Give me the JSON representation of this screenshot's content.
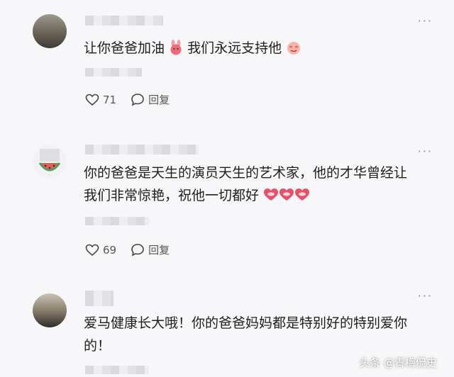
{
  "comments": [
    {
      "text_a": "让你爸爸加油",
      "text_b": "我们永远支持他",
      "likes": "71",
      "reply_label": "回复",
      "more": "···"
    },
    {
      "text_line1": "你的爸爸是天生的演员天生的艺术家，他的才华曾经让",
      "text_line2": "我们非常惊艳，祝他一切都好",
      "likes": "69",
      "reply_label": "回复",
      "more": "···"
    },
    {
      "text_line1": "爱马健康长大哦！你的爸爸妈妈都是特别好的特别爱你",
      "text_line2": "的！",
      "more": "···"
    }
  ],
  "watermark": "头条 @青梅侃史",
  "icons": {
    "like": "heart-outline-icon",
    "reply": "speech-bubble-icon",
    "more": "more-dots-icon"
  }
}
